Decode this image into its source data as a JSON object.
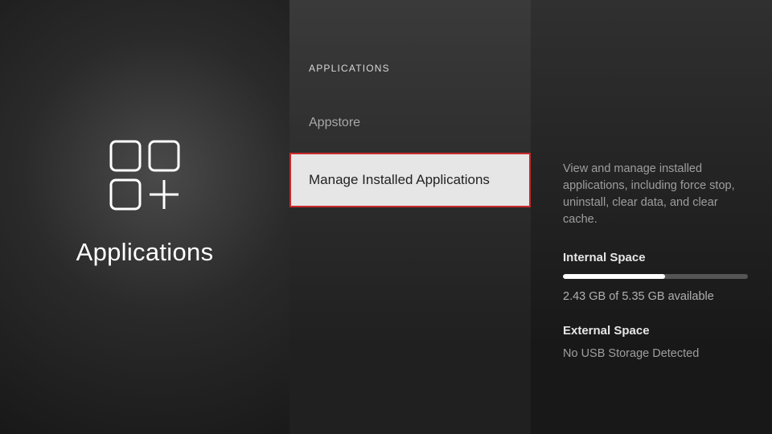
{
  "sidebar": {
    "title": "Applications"
  },
  "middle": {
    "heading": "APPLICATIONS",
    "items": [
      {
        "label": "Appstore",
        "selected": false
      },
      {
        "label": "Manage Installed Applications",
        "selected": true
      }
    ]
  },
  "detail": {
    "description": "View and manage installed applications, including force stop, uninstall, clear data, and clear cache.",
    "internal": {
      "label": "Internal Space",
      "used_gb": 2.92,
      "total_gb": 5.35,
      "text": "2.43 GB of 5.35 GB available",
      "fill_percent": 55
    },
    "external": {
      "label": "External Space",
      "text": "No USB Storage Detected"
    }
  }
}
